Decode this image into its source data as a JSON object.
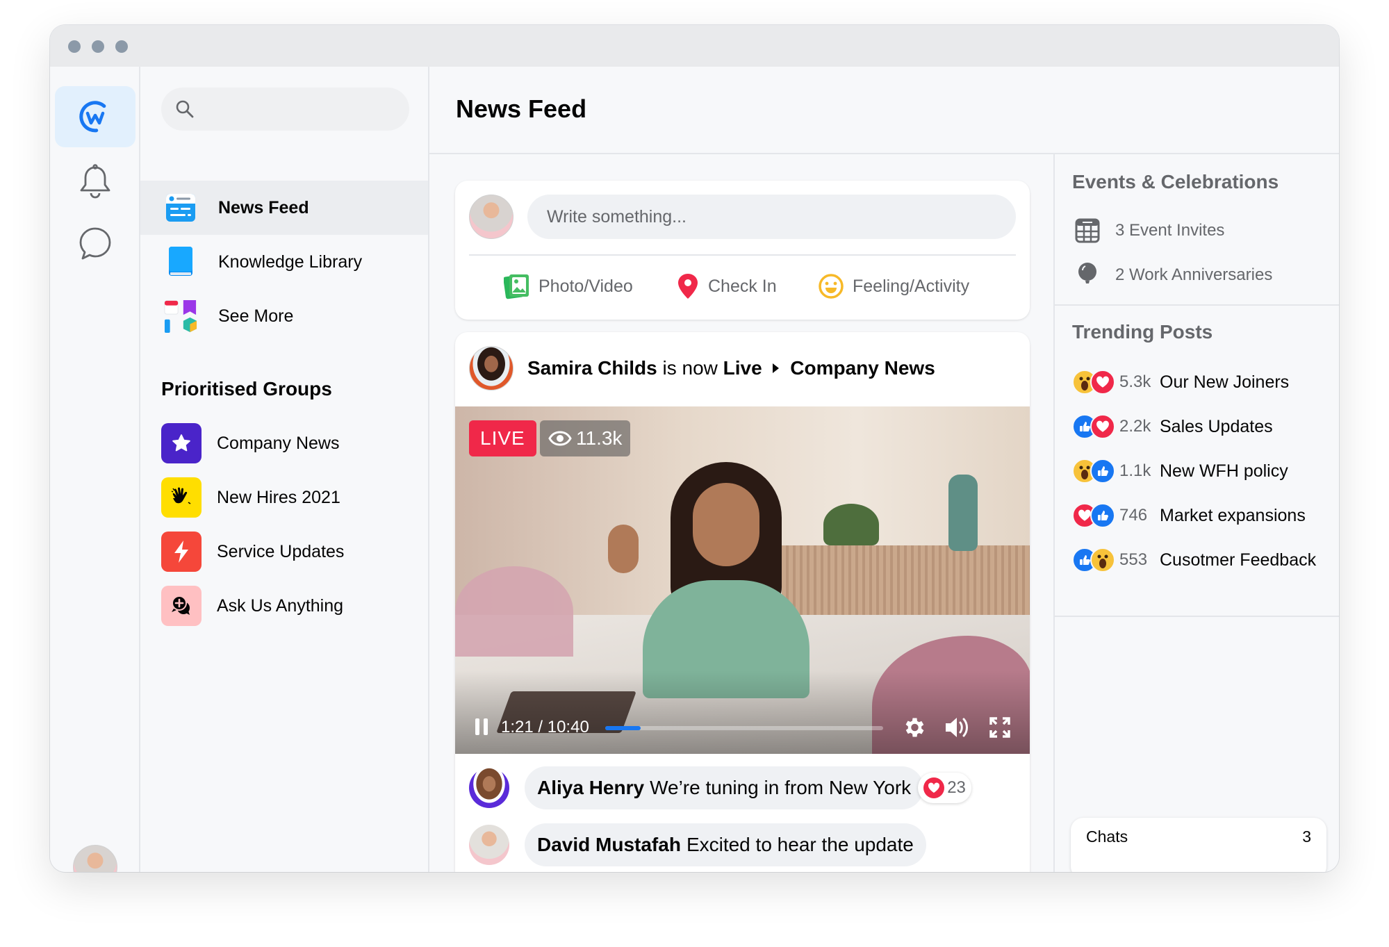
{
  "window": {
    "controls": [
      "close",
      "minimize",
      "maximize"
    ]
  },
  "rail": {
    "items": [
      {
        "name": "workplace-logo",
        "active": true
      },
      {
        "name": "notifications"
      },
      {
        "name": "chats"
      }
    ],
    "user_online": true
  },
  "nav": {
    "search": {
      "placeholder": "",
      "value": ""
    },
    "items": [
      {
        "label": "News Feed",
        "active": true,
        "icon": "news-feed-icon"
      },
      {
        "label": "Knowledge Library",
        "icon": "book-icon"
      },
      {
        "label": "See More",
        "icon": "apps-icon"
      }
    ],
    "groups_title": "Prioritised Groups",
    "groups": [
      {
        "label": "Company News",
        "icon": "star-icon",
        "color": "#4a24c9"
      },
      {
        "label": "New Hires 2021",
        "icon": "wave-hand-icon",
        "color": "#ffde00"
      },
      {
        "label": "Service Updates",
        "icon": "lightning-icon",
        "color": "#f5473a"
      },
      {
        "label": "Ask Us Anything",
        "icon": "question-chat-icon",
        "color": "#ffc0c2"
      }
    ]
  },
  "main": {
    "title": "News Feed",
    "composer": {
      "placeholder": "Write something...",
      "actions": [
        {
          "label": "Photo/Video",
          "icon": "photo-icon",
          "color": "#45bd62"
        },
        {
          "label": "Check In",
          "icon": "location-pin-icon",
          "color": "#f02849"
        },
        {
          "label": "Feeling/Activity",
          "icon": "smiley-icon",
          "color": "#f7b928"
        }
      ]
    },
    "post": {
      "author": "Samira Childs",
      "middle": "is now",
      "status": "Live",
      "group": "Company News",
      "video": {
        "live_label": "LIVE",
        "views": "11.3k",
        "current_time": "1:21",
        "separator": "/",
        "duration": "10:40",
        "progress": 0.127
      },
      "comments": [
        {
          "author": "Aliya Henry",
          "text": "We’re tuning in from New York",
          "reactions": "23"
        },
        {
          "author": "David Mustafah",
          "text": "Excited to hear the update"
        }
      ]
    }
  },
  "right": {
    "events_title": "Events & Celebrations",
    "events": [
      {
        "label": "3 Event Invites",
        "icon": "calendar-icon"
      },
      {
        "label": "2 Work Anniversaries",
        "icon": "balloon-icon"
      }
    ],
    "trending_title": "Trending Posts",
    "trending": [
      {
        "reactions": [
          "wow",
          "love"
        ],
        "count": "5.3k",
        "title": "Our New Joiners"
      },
      {
        "reactions": [
          "like",
          "love"
        ],
        "count": "2.2k",
        "title": "Sales Updates"
      },
      {
        "reactions": [
          "wow",
          "like"
        ],
        "count": "1.1k",
        "title": "New WFH policy"
      },
      {
        "reactions": [
          "love",
          "like"
        ],
        "count": "746",
        "title": "Market expansions"
      },
      {
        "reactions": [
          "like",
          "wow"
        ],
        "count": "553",
        "title": "Cusotmer Feedback"
      }
    ],
    "chats": {
      "label": "Chats",
      "count": "3"
    }
  },
  "colors": {
    "accent": "#1877f2",
    "live": "#f02849",
    "online": "#31a24c"
  }
}
